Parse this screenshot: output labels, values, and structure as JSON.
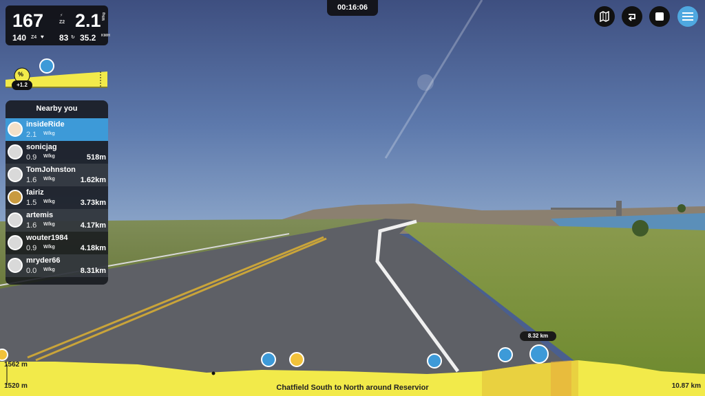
{
  "stats": {
    "power": "167",
    "power_zone": "Z2",
    "wkg": "2.1",
    "wkg_unit": "W/kg",
    "heart_rate": "140",
    "hr_zone": "Z4",
    "cadence": "83",
    "speed": "35.2",
    "speed_unit": "KM/H"
  },
  "grade": {
    "label": "%",
    "value": "+1.2"
  },
  "timer": "00:16:06",
  "top_buttons": [
    {
      "name": "map-icon"
    },
    {
      "name": "loop-icon"
    },
    {
      "name": "stop-icon"
    },
    {
      "name": "menu-icon"
    }
  ],
  "nearby": {
    "title": "Nearby you",
    "riders": [
      {
        "name": "insideRide",
        "wkg": "2.1",
        "unit": "W/kg",
        "distance": ""
      },
      {
        "name": "sonicjag",
        "wkg": "0.9",
        "unit": "W/kg",
        "distance": "518m"
      },
      {
        "name": "TomJohnston",
        "wkg": "1.6",
        "unit": "W/kg",
        "distance": "1.62km"
      },
      {
        "name": "fairiz",
        "wkg": "1.5",
        "unit": "W/kg",
        "distance": "3.73km"
      },
      {
        "name": "artemis",
        "wkg": "1.6",
        "unit": "W/kg",
        "distance": "4.17km"
      },
      {
        "name": "wouter1984",
        "wkg": "0.9",
        "unit": "W/kg",
        "distance": "4.18km"
      },
      {
        "name": "mryder66",
        "wkg": "0.0",
        "unit": "W/kg",
        "distance": "8.31km"
      }
    ]
  },
  "profile": {
    "course_name": "Chatfield South to North around Reservior",
    "elev_high": "1562 m",
    "elev_low": "1520 m",
    "total_distance": "10.87 km",
    "marker_distance": "8.32 km"
  },
  "colors": {
    "accent": "#3d9ad8",
    "profile_yellow": "#f2ea4a",
    "panel": "#141418"
  }
}
